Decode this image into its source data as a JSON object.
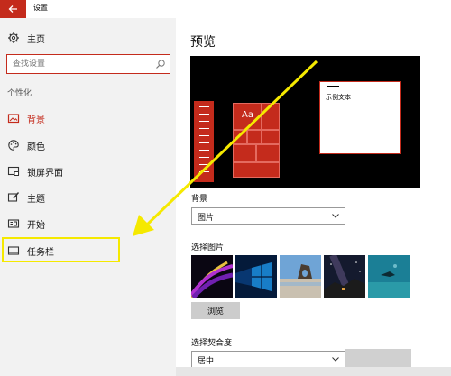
{
  "window": {
    "title": "设置",
    "back_icon": "arrow-left-icon",
    "accent": "#c42b1c"
  },
  "sidebar": {
    "home": {
      "label": "主页",
      "icon": "gear-icon"
    },
    "search": {
      "placeholder": "查找设置",
      "icon": "search-icon"
    },
    "section_label": "个性化",
    "items": [
      {
        "label": "背景",
        "icon": "picture-icon",
        "active": true
      },
      {
        "label": "颜色",
        "icon": "palette-icon"
      },
      {
        "label": "锁屏界面",
        "icon": "lock-screen-icon"
      },
      {
        "label": "主题",
        "icon": "brush-icon"
      },
      {
        "label": "开始",
        "icon": "start-menu-icon"
      },
      {
        "label": "任务栏",
        "icon": "taskbar-icon"
      }
    ]
  },
  "main": {
    "preview_heading": "预览",
    "preview": {
      "tile_text": "Aa",
      "sample_text": "示例文本"
    },
    "background": {
      "label": "背景",
      "value": "图片"
    },
    "choose_picture": {
      "label": "选择图片",
      "thumbnails": [
        "purple-ribbon",
        "windows-10-blue",
        "beach-rock-arch",
        "night-sky",
        "underwater-diver"
      ],
      "browse_label": "浏览"
    },
    "fit": {
      "label": "选择契合度",
      "value": "居中"
    }
  },
  "annotation": {
    "arrow_color": "#f5e900",
    "highlight_color": "#f5e900"
  }
}
